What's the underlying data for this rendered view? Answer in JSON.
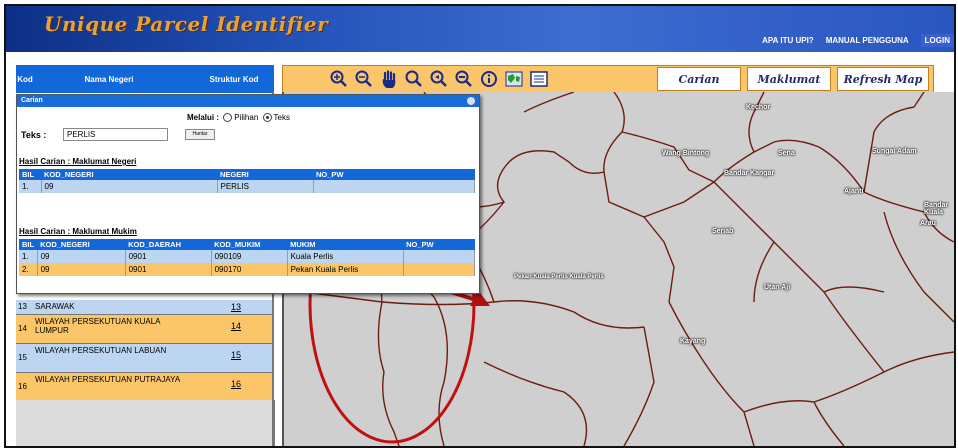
{
  "header": {
    "title": "Unique Parcel Identifier",
    "nav": [
      "APA ITU UPI?",
      "MANUAL PENGGUNA",
      "LOGIN"
    ]
  },
  "toolbar": {
    "tools": [
      "zoom-in-icon",
      "zoom-out-icon",
      "pan-hand-icon",
      "zoom-extent-icon",
      "zoom-prev-icon",
      "zoom-next-icon",
      "info-icon",
      "map-layers-icon",
      "legend-list-icon"
    ],
    "tabs": [
      "Carian",
      "Maklumat",
      "Refresh Map"
    ]
  },
  "left_panel": {
    "headers": [
      "Kod",
      "Nama Negeri",
      "Struktur Kod"
    ],
    "rows": [
      {
        "kod": "13",
        "name": "SARAWAK",
        "link": "13"
      },
      {
        "kod": "14",
        "name": "WILAYAH PERSEKUTUAN KUALA LUMPUR",
        "link": "14"
      },
      {
        "kod": "15",
        "name": "WILAYAH PERSEKUTUAN LABUAN",
        "link": "15"
      },
      {
        "kod": "16",
        "name": "WILAYAH PERSEKUTUAN PUTRAJAYA",
        "link": "16"
      }
    ]
  },
  "search": {
    "title": "Carian",
    "melalui_label": "Melalui :",
    "option_pilihan": "Pilihan",
    "option_teks": "Teks",
    "teks_label": "Teks :",
    "teks_value": "PERLIS",
    "button": "Hantar",
    "negeri_section": "Hasil Carian : Maklumat Negeri",
    "negeri_headers": [
      "BIL",
      "KOD_NEGERI",
      "NEGERI",
      "NO_PW"
    ],
    "negeri_rows": [
      [
        "1.",
        "09",
        "PERLIS",
        ""
      ]
    ],
    "mukim_section": "Hasil Carian : Maklumat Mukim",
    "mukim_headers": [
      "BIL",
      "KOD_NEGERI",
      "KOD_DAERAH",
      "KOD_MUKIM",
      "MUKIM",
      "NO_PW"
    ],
    "mukim_rows": [
      [
        "1.",
        "09",
        "0901",
        "090109",
        "Kuala Perlis",
        ""
      ],
      [
        "2.",
        "09",
        "0901",
        "090170",
        "Pekan Kuala Perlis",
        ""
      ]
    ]
  },
  "map": {
    "labels": [
      "Kechor",
      "Wang Bintong",
      "Sena",
      "Bandar Kangar",
      "Sungai Adam",
      "Ajanti",
      "Bandar Kuala",
      "Arau",
      "Seriab",
      "Pekan Kuala Perlis Kuala Perlis",
      "Utan Aji",
      "Kayang"
    ]
  }
}
